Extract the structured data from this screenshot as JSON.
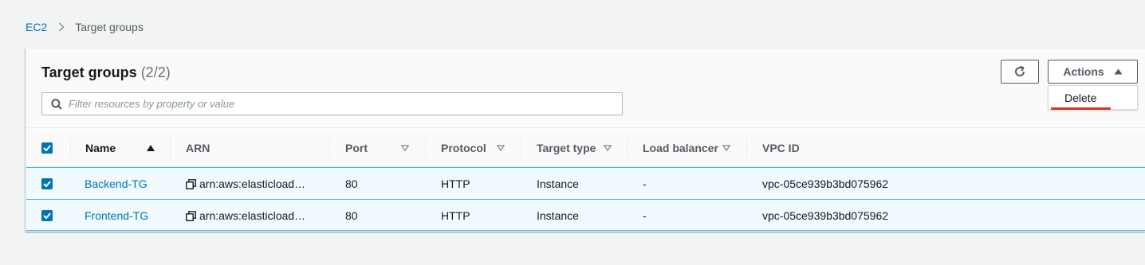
{
  "breadcrumb": {
    "root": "EC2",
    "current": "Target groups"
  },
  "panel": {
    "title": "Target groups",
    "count": "(2/2)"
  },
  "filter": {
    "placeholder": "Filter resources by property or value"
  },
  "toolbar": {
    "refresh_icon": "refresh-icon",
    "actions_label": "Actions"
  },
  "actions_menu": {
    "items": [
      {
        "label": "Delete"
      }
    ]
  },
  "table": {
    "columns": [
      {
        "label": "Name",
        "sort": "ascending"
      },
      {
        "label": "ARN"
      },
      {
        "label": "Port"
      },
      {
        "label": "Protocol"
      },
      {
        "label": "Target type"
      },
      {
        "label": "Load balancer"
      },
      {
        "label": "VPC ID"
      }
    ],
    "rows": [
      {
        "name": "Backend-TG",
        "arn": "arn:aws:elasticload…",
        "port": "80",
        "protocol": "HTTP",
        "target_type": "Instance",
        "load_balancer": "-",
        "vpc_id": "vpc-05ce939b3bd075962"
      },
      {
        "name": "Frontend-TG",
        "arn": "arn:aws:elasticload…",
        "port": "80",
        "protocol": "HTTP",
        "target_type": "Instance",
        "load_balancer": "-",
        "vpc_id": "vpc-05ce939b3bd075962"
      }
    ]
  },
  "colors": {
    "link": "#0073bb",
    "selected_row_bg": "#f1faff",
    "selected_row_border": "#44b9d6",
    "menu_underline": "#e0301e"
  }
}
